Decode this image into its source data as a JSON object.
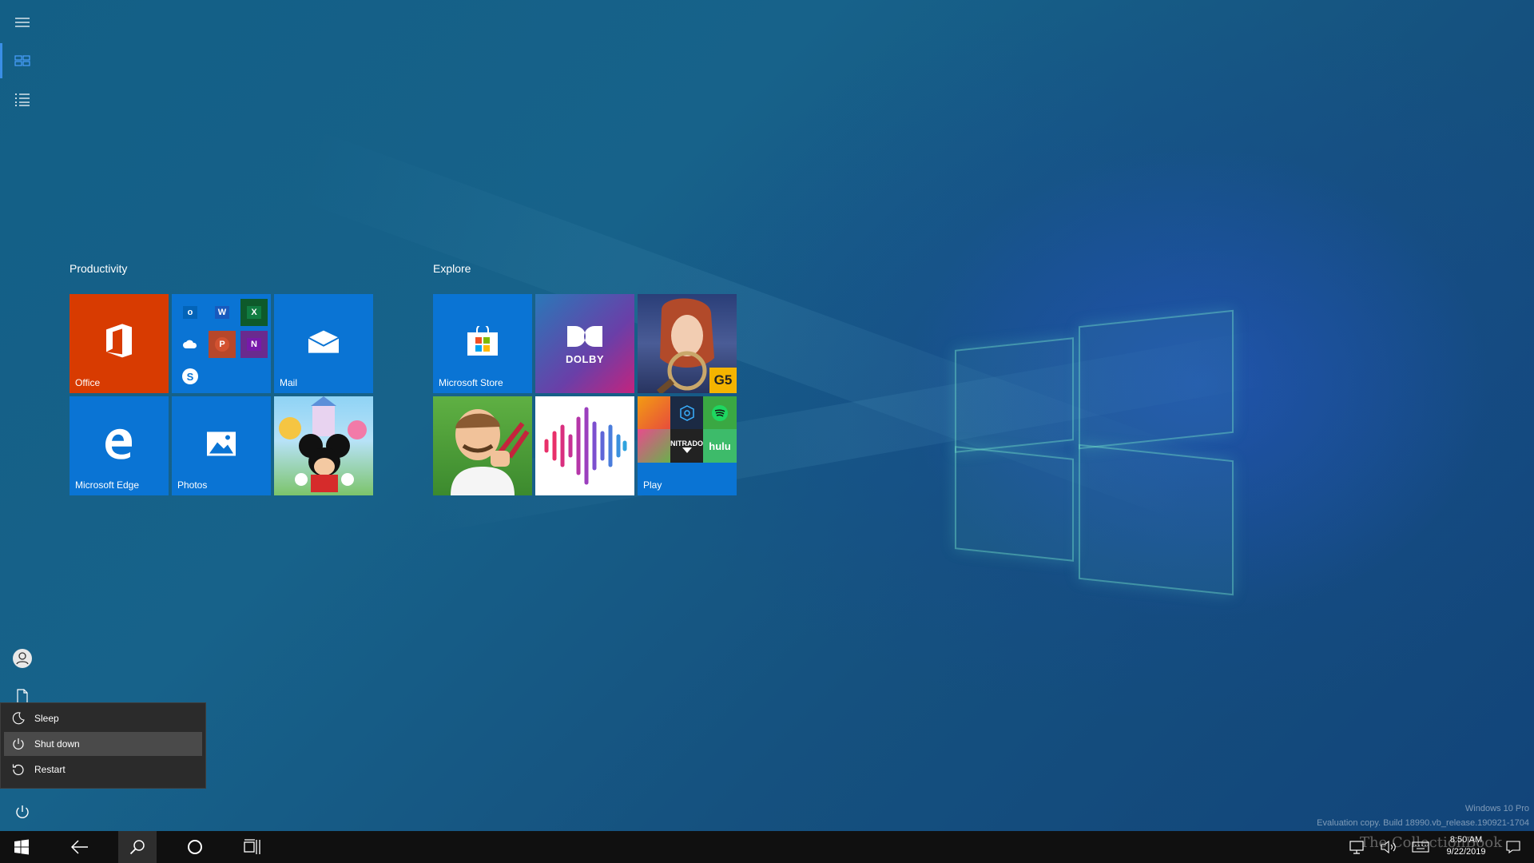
{
  "start": {
    "groups": [
      {
        "title": "Productivity"
      },
      {
        "title": "Explore"
      }
    ],
    "tiles": {
      "office": "Office",
      "mail": "Mail",
      "edge": "Microsoft Edge",
      "photos": "Photos",
      "store": "Microsoft Store",
      "play": "Play",
      "dolby": "DOLBY",
      "g5": "G5",
      "nitrado": "NITRADO",
      "hulu": "hulu"
    }
  },
  "power_menu": {
    "items": [
      {
        "label": "Sleep",
        "icon": "moon-icon"
      },
      {
        "label": "Shut down",
        "icon": "power-icon",
        "selected": true
      },
      {
        "label": "Restart",
        "icon": "restart-icon"
      }
    ]
  },
  "taskbar": {
    "clock_time": "8:50 AM",
    "clock_date": "9/22/2019"
  },
  "watermark": {
    "edition": "Windows 10 Pro",
    "build": "Evaluation copy. Build 18990.vb_release.190921-1704",
    "site": "The CollectionBook"
  },
  "colors": {
    "accent": "#0078d7",
    "office": "#d83b01",
    "menu_bg": "#2b2b2b",
    "taskbar_bg": "#101010"
  }
}
